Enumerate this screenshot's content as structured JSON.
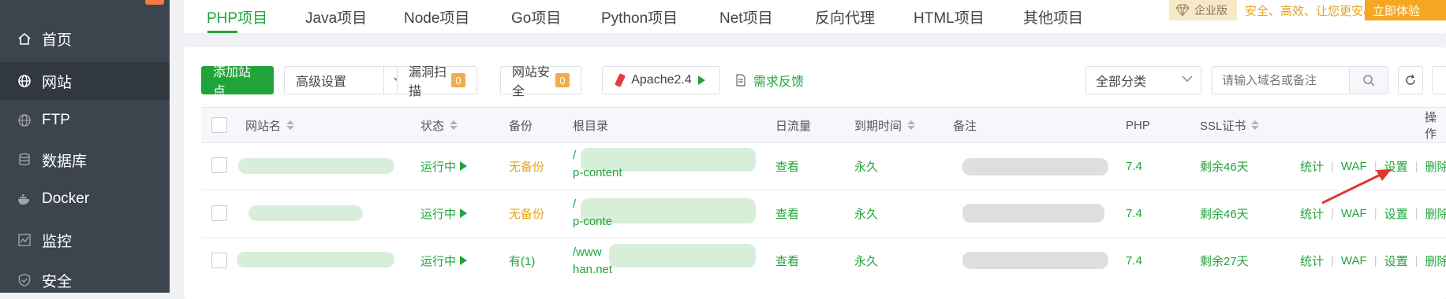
{
  "sidebar": {
    "items": [
      {
        "label": "首页",
        "icon": "home-icon"
      },
      {
        "label": "网站",
        "icon": "globe-icon"
      },
      {
        "label": "FTP",
        "icon": "ftp-globe-icon"
      },
      {
        "label": "数据库",
        "icon": "database-icon"
      },
      {
        "label": "Docker",
        "icon": "docker-icon"
      },
      {
        "label": "监控",
        "icon": "monitor-icon"
      },
      {
        "label": "安全",
        "icon": "shield-icon"
      }
    ],
    "active_index": 1
  },
  "tabs": [
    "PHP项目",
    "Java项目",
    "Node项目",
    "Go项目",
    "Python项目",
    "Net项目",
    "反向代理",
    "HTML项目",
    "其他项目"
  ],
  "enterprise": {
    "badge": "企业版",
    "slogan": "安全、高效、让您更安心",
    "button": "立即体验"
  },
  "toolbar": {
    "add_site": "添加站点",
    "advanced": "高级设置",
    "vuln_scan": "漏洞扫描",
    "vuln_count": "0",
    "site_security": "网站安全",
    "security_count": "0",
    "apache": "Apache2.4",
    "feedback": "需求反馈",
    "category": "全部分类",
    "search_placeholder": "请输入域名或备注"
  },
  "table": {
    "headers": {
      "name": "网站名",
      "status": "状态",
      "backup": "备份",
      "root": "根目录",
      "traffic": "日流量",
      "expire": "到期时间",
      "remark": "备注",
      "php": "PHP",
      "ssl": "SSL证书",
      "actions": "操作"
    },
    "rows": [
      {
        "status": "运行中",
        "backup": "无备份",
        "root_line1": "/",
        "root_line2": "p-content",
        "traffic": "查看",
        "expire": "永久",
        "php": "7.4",
        "ssl": "剩余46天",
        "act_stats": "统计",
        "act_waf": "WAF",
        "act_settings": "设置",
        "act_delete": "删除"
      },
      {
        "status": "运行中",
        "backup": "无备份",
        "root_line1": "/",
        "root_line2": "p-content/uploads",
        "traffic": "查看",
        "expire": "永久",
        "php": "7.4",
        "ssl": "剩余46天",
        "act_stats": "统计",
        "act_waf": "WAF",
        "act_settings": "设置",
        "act_delete": "删除"
      },
      {
        "status": "运行中",
        "backup": "有(1)",
        "root_line1": "/www",
        "root_line2": "han.net",
        "traffic": "查看",
        "expire": "永久",
        "php": "7.4",
        "ssl": "剩余27天",
        "act_stats": "统计",
        "act_waf": "WAF",
        "act_settings": "设置",
        "act_delete": "删除"
      }
    ]
  },
  "colors": {
    "accent": "#20a53a",
    "warning": "#e8a21c",
    "sidebar": "#3c444d",
    "annotation_arrow": "#e0392b"
  }
}
